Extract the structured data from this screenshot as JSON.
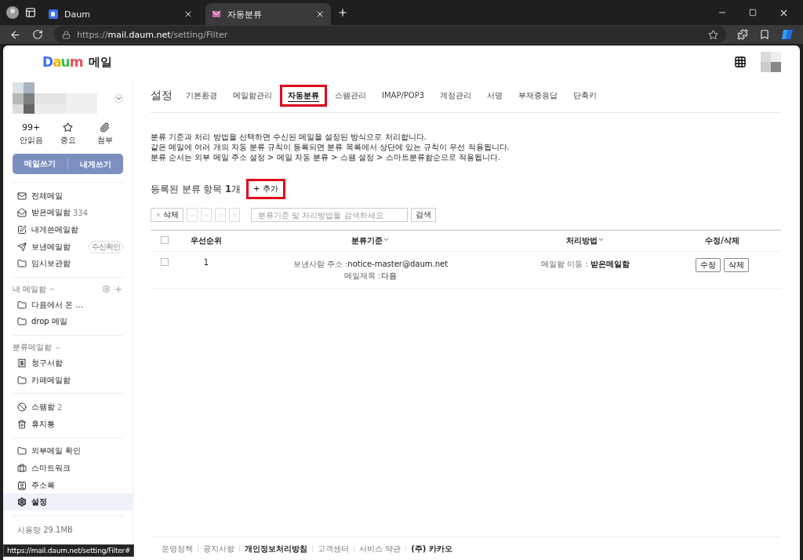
{
  "browser": {
    "tabs": [
      {
        "title": "Daum",
        "kind": "daum",
        "selected": false
      },
      {
        "title": "자동분류",
        "kind": "mail",
        "selected": true
      }
    ],
    "url": "https://**mail.daum.net**/setting/Filter"
  },
  "header": {
    "logo": "Daum",
    "service": "메일"
  },
  "sidebar": {
    "counters": [
      {
        "kind": "count",
        "value": "99+",
        "label": "안읽음"
      },
      {
        "kind": "star",
        "label": "중요"
      },
      {
        "kind": "clip",
        "label": "첨부"
      }
    ],
    "compose": [
      "메일쓰기",
      "내게쓰기"
    ],
    "groups": [
      {
        "items": [
          {
            "kind": "all",
            "label": "전체메일",
            "selected": false
          },
          {
            "kind": "inbox",
            "label": "받은메일함",
            "count": "334",
            "selected": false
          },
          {
            "kind": "self",
            "label": "내게쓴메일함",
            "selected": false
          },
          {
            "kind": "sent",
            "label": "보낸메일함",
            "badge": "수신확인",
            "selected": false
          },
          {
            "kind": "folder",
            "label": "임시보관함",
            "selected": false
          }
        ]
      },
      {
        "title": "내 메일함",
        "expanded": true,
        "tools": true,
        "items": [
          {
            "kind": "folder",
            "label": "다음에서 온 ...",
            "selected": false
          },
          {
            "kind": "folder",
            "label": "drop 메일",
            "selected": false
          }
        ]
      },
      {
        "title": "분류메일함",
        "expanded": true,
        "items": [
          {
            "kind": "bill",
            "label": "청구서함",
            "selected": false
          },
          {
            "kind": "folder",
            "label": "카페메일함",
            "selected": false
          }
        ]
      },
      {
        "items": [
          {
            "kind": "spam",
            "label": "스팸함",
            "count": "2",
            "selected": false
          },
          {
            "kind": "trash",
            "label": "휴지통",
            "selected": false
          }
        ]
      },
      {
        "items": [
          {
            "kind": "folder",
            "label": "외부메일 확인",
            "selected": false
          },
          {
            "kind": "work",
            "label": "스마트워크",
            "selected": false
          },
          {
            "kind": "contacts",
            "label": "주소록",
            "selected": false
          },
          {
            "kind": "settings",
            "label": "설정",
            "selected": true
          }
        ]
      }
    ],
    "usage": "사용량 29.1MB"
  },
  "settings": {
    "title": "설정",
    "tabs": [
      {
        "label": "기본환경",
        "selected": false,
        "highlighted": false
      },
      {
        "label": "메일함관리",
        "selected": false,
        "highlighted": false
      },
      {
        "label": "자동분류",
        "selected": true,
        "highlighted": true
      },
      {
        "label": "스팸관리",
        "selected": false,
        "highlighted": false
      },
      {
        "label": "IMAP/POP3",
        "selected": false,
        "highlighted": false
      },
      {
        "label": "계정관리",
        "selected": false,
        "highlighted": false
      },
      {
        "label": "서명",
        "selected": false,
        "highlighted": false
      },
      {
        "label": "부재중응답",
        "selected": false,
        "highlighted": false
      },
      {
        "label": "단축키",
        "selected": false,
        "highlighted": false
      }
    ],
    "description": [
      "분류 기준과 처리 방법을 선택하면 수신된 메일을 설정된 방식으로 처리합니다.",
      "같은 메일에 여러 개의 자동 분류 규칙이 등록되면 분류 목록에서 상단에 있는 규칙이 우선 적용됩니다.",
      "분류 순서는 외부 메일 주소 설정 > 메일 자동 분류 > 스팸 설정 > 스마트분류함순으로 적용됩니다."
    ],
    "count_heading": "등록된 분류 항목 **1**개",
    "add_button": {
      "label": "+ 추가",
      "highlighted": true
    },
    "toolbar": {
      "delete": "삭제",
      "moves": [
        {
          "kind": "up",
          "disabled": true
        },
        {
          "kind": "down",
          "disabled": true
        },
        {
          "kind": "top",
          "disabled": true
        },
        {
          "kind": "bottom",
          "disabled": true
        }
      ],
      "search": {
        "placeholder": "분류기준 및 처리방법을 검색하세요"
      },
      "search_button": "검색"
    },
    "table": {
      "select_all_checked": false,
      "columns": [
        {
          "kind": "check"
        },
        {
          "kind": "text",
          "label": "우선순위"
        },
        {
          "kind": "sort",
          "label": "분류기준"
        },
        {
          "kind": "sort",
          "label": "처리방법"
        },
        {
          "kind": "text",
          "label": "수정/삭제"
        }
      ],
      "rows": [
        {
          "checked": false,
          "priority": "1",
          "criteria": [
            {
              "label": "보낸사람 주소 :",
              "value": "notice-master@daum.net"
            },
            {
              "label": "메일제목 :",
              "value": "다음"
            }
          ],
          "action": {
            "label": "메일함 이동 : ",
            "value": "받은메일함"
          },
          "buttons": [
            "수정",
            "삭제"
          ]
        }
      ]
    }
  },
  "footer": [
    {
      "label": "운영정책",
      "bold": false
    },
    {
      "label": "공지사항",
      "bold": false
    },
    {
      "label": "개인정보처리방침",
      "bold": true
    },
    {
      "label": "고객센터",
      "bold": false
    },
    {
      "label": "서비스 약관",
      "bold": false
    },
    {
      "label": "(주) 카카오",
      "bold": true
    }
  ],
  "status_url": "https://mail.daum.net/setting/Filter#"
}
